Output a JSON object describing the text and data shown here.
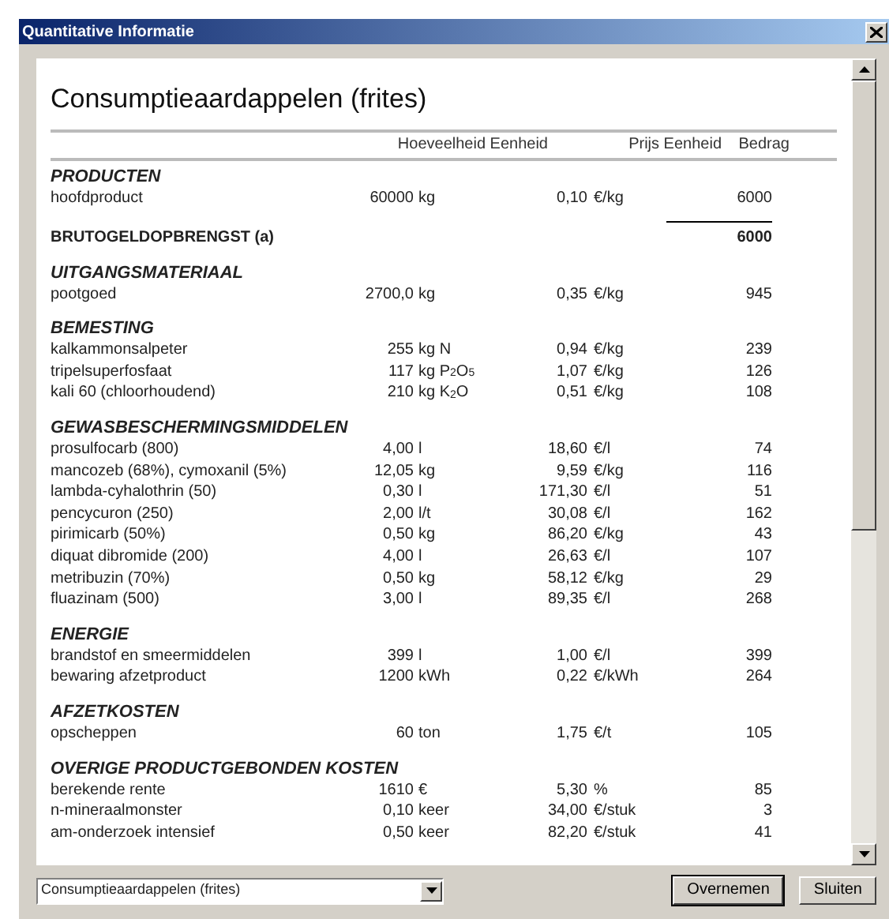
{
  "window": {
    "title": "Quantitative Informatie"
  },
  "report": {
    "title": "Consumptieaardappelen (frites)",
    "columns": [
      "Hoeveelheid Eenheid",
      "Prijs Eenheid",
      "Bedrag"
    ],
    "sections": [
      {
        "kind": "group",
        "heading": "PRODUCTEN",
        "rows": [
          {
            "name": "hoofdproduct",
            "quantity": "60000",
            "unit": "kg",
            "price": "0,10",
            "price_unit": "€/kg",
            "amount": "6000"
          }
        ]
      },
      {
        "kind": "total",
        "label": "BRUTOGELDOPBRENGST (a)",
        "amount": "6000"
      },
      {
        "kind": "group",
        "heading": "UITGANGSMATERIAAL",
        "rows": [
          {
            "name": "pootgoed",
            "quantity": "2700,0",
            "unit": "kg",
            "price": "0,35",
            "price_unit": "€/kg",
            "amount": "945"
          }
        ]
      },
      {
        "kind": "group",
        "heading": "BEMESTING",
        "rows": [
          {
            "name": "kalkammonsalpeter",
            "quantity": "255",
            "unit": "kg N",
            "price": "0,94",
            "price_unit": "€/kg",
            "amount": "239"
          },
          {
            "name": "tripelsuperfosfaat",
            "quantity": "117",
            "unit": "kg P$_{2}$O$_{5}$",
            "price": "1,07",
            "price_unit": "€/kg",
            "amount": "126"
          },
          {
            "name": "kali 60 (chloorhoudend)",
            "quantity": "210",
            "unit": "kg K$_{2}$O",
            "price": "0,51",
            "price_unit": "€/kg",
            "amount": "108"
          }
        ]
      },
      {
        "kind": "group",
        "heading": "GEWASBESCHERMINGSMIDDELEN",
        "rows": [
          {
            "name": "prosulfocarb (800)",
            "quantity": "4,00",
            "unit": "l",
            "price": "18,60",
            "price_unit": "€/l",
            "amount": "74"
          },
          {
            "name": "mancozeb (68%), cymoxanil (5%)",
            "quantity": "12,05",
            "unit": "kg",
            "price": "9,59",
            "price_unit": "€/kg",
            "amount": "116"
          },
          {
            "name": "lambda-cyhalothrin (50)",
            "quantity": "0,30",
            "unit": "l",
            "price": "171,30",
            "price_unit": "€/l",
            "amount": "51"
          },
          {
            "name": "pencycuron (250)",
            "quantity": "2,00",
            "unit": "l/t",
            "price": "30,08",
            "price_unit": "€/l",
            "amount": "162"
          },
          {
            "name": "pirimicarb (50%)",
            "quantity": "0,50",
            "unit": "kg",
            "price": "86,20",
            "price_unit": "€/kg",
            "amount": "43"
          },
          {
            "name": "diquat dibromide (200)",
            "quantity": "4,00",
            "unit": "l",
            "price": "26,63",
            "price_unit": "€/l",
            "amount": "107"
          },
          {
            "name": "metribuzin (70%)",
            "quantity": "0,50",
            "unit": "kg",
            "price": "58,12",
            "price_unit": "€/kg",
            "amount": "29"
          },
          {
            "name": "fluazinam (500)",
            "quantity": "3,00",
            "unit": "l",
            "price": "89,35",
            "price_unit": "€/l",
            "amount": "268"
          }
        ]
      },
      {
        "kind": "group",
        "heading": "ENERGIE",
        "rows": [
          {
            "name": "brandstof en smeermiddelen",
            "quantity": "399",
            "unit": "l",
            "price": "1,00",
            "price_unit": "€/l",
            "amount": "399"
          },
          {
            "name": "bewaring afzetproduct",
            "quantity": "1200",
            "unit": "kWh",
            "price": "0,22",
            "price_unit": "€/kWh",
            "amount": "264"
          }
        ]
      },
      {
        "kind": "group",
        "heading": "AFZETKOSTEN",
        "rows": [
          {
            "name": "opscheppen",
            "quantity": "60",
            "unit": "ton",
            "price": "1,75",
            "price_unit": "€/t",
            "amount": "105"
          }
        ]
      },
      {
        "kind": "group",
        "heading": "OVERIGE PRODUCTGEBONDEN KOSTEN",
        "rows": [
          {
            "name": "berekende rente",
            "quantity": "1610",
            "unit": "€",
            "price": "5,30",
            "price_unit": "%",
            "amount": "85"
          },
          {
            "name": "n-mineraalmonster",
            "quantity": "0,10",
            "unit": "keer",
            "price": "34,00",
            "price_unit": "€/stuk",
            "amount": "3"
          },
          {
            "name": "am-onderzoek intensief",
            "quantity": "0,50",
            "unit": "keer",
            "price": "82,20",
            "price_unit": "€/stuk",
            "amount": "41"
          }
        ]
      }
    ]
  },
  "footer": {
    "selector": {
      "value": "Consumptieaardappelen (frites)"
    },
    "buttons": [
      {
        "label": "Overnemen",
        "default": true
      },
      {
        "label": "Sluiten",
        "default": false
      }
    ]
  }
}
